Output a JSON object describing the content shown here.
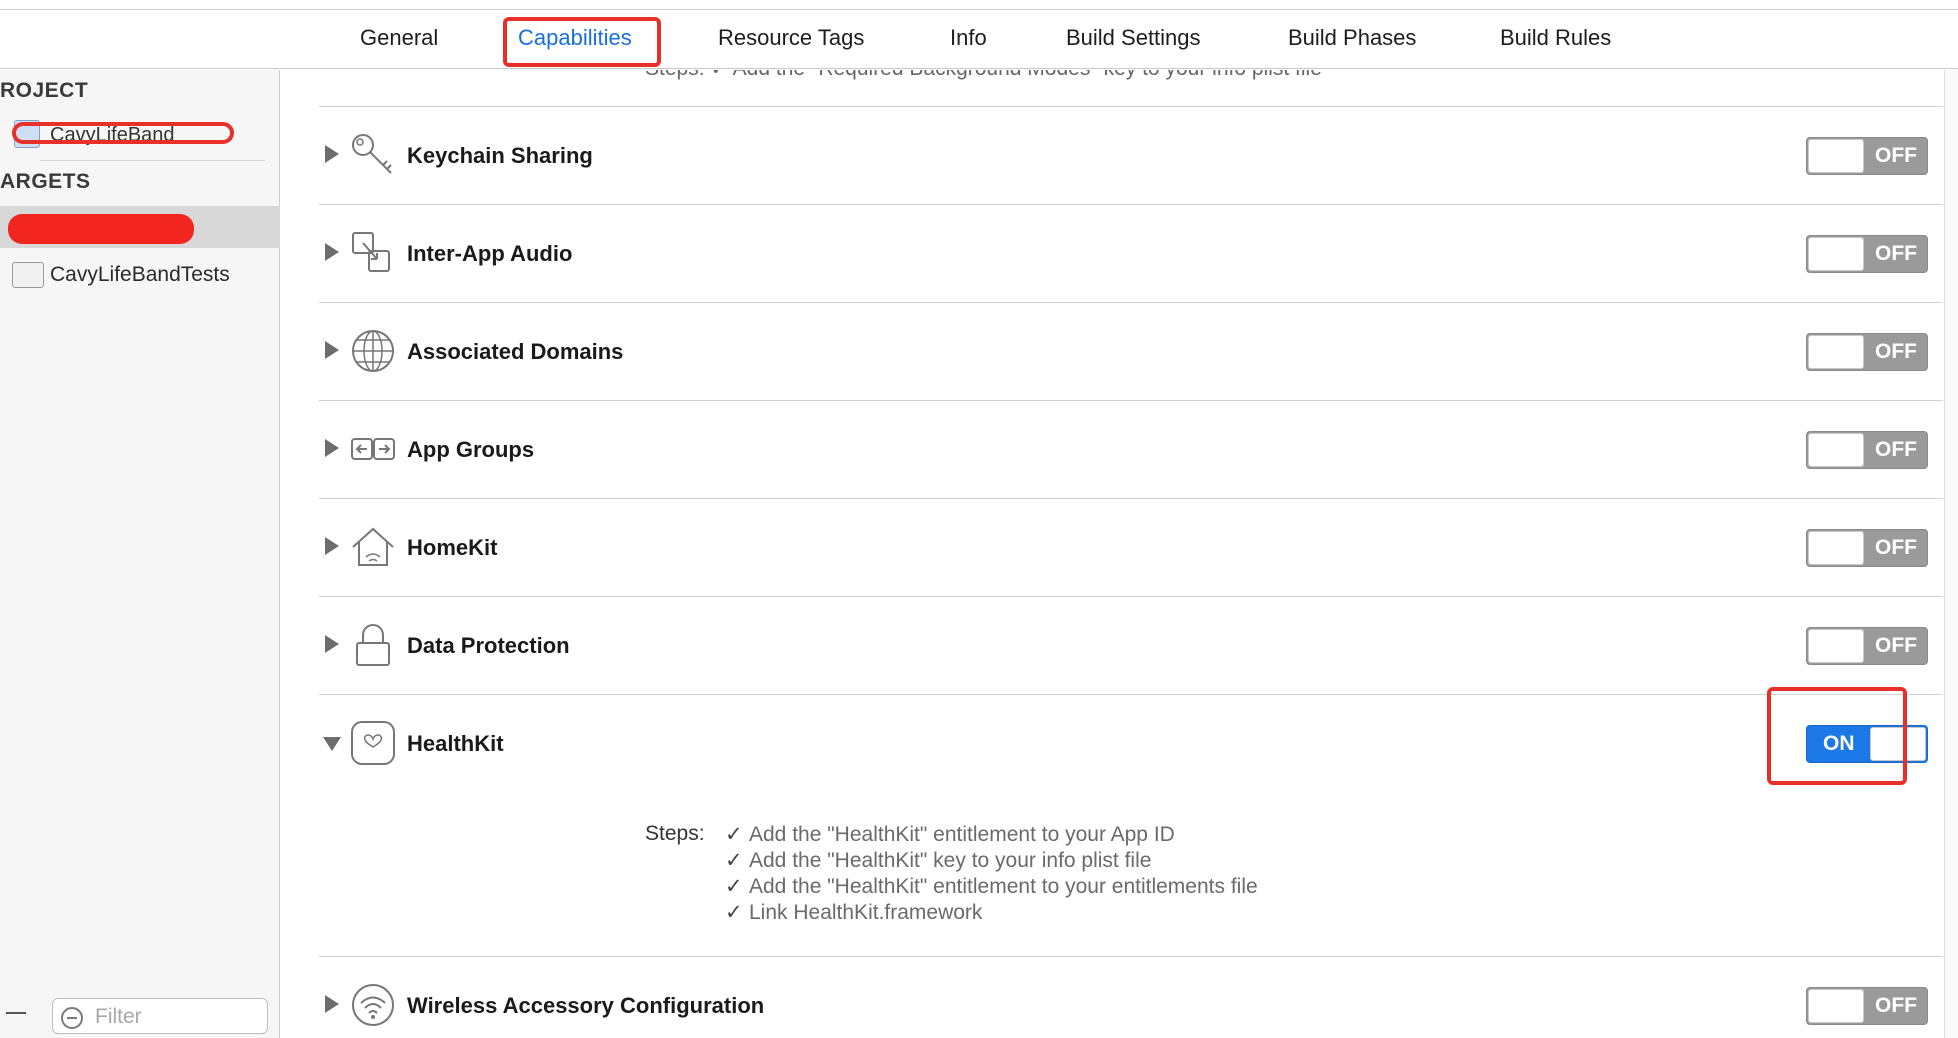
{
  "tabs": [
    {
      "label": "General"
    },
    {
      "label": "Capabilities"
    },
    {
      "label": "Resource Tags"
    },
    {
      "label": "Info"
    },
    {
      "label": "Build Settings"
    },
    {
      "label": "Build Phases"
    },
    {
      "label": "Build Rules"
    }
  ],
  "sidebar": {
    "project_header": "ROJECT",
    "project_item": "CavyLifeBand",
    "targets_header": "ARGETS",
    "targets": [
      {
        "label": ""
      },
      {
        "label": "CavyLifeBandTests"
      }
    ],
    "filter_placeholder": "Filter"
  },
  "main": {
    "cutoff_text": "Steps: ✓ Add the \"Required Background Modes\" key to your info plist file",
    "capabilities": [
      {
        "title": "Keychain Sharing",
        "icon": "key-icon",
        "state": "OFF"
      },
      {
        "title": "Inter-App Audio",
        "icon": "inter-app-audio-icon",
        "state": "OFF"
      },
      {
        "title": "Associated Domains",
        "icon": "globe-icon",
        "state": "OFF"
      },
      {
        "title": "App Groups",
        "icon": "app-groups-icon",
        "state": "OFF"
      },
      {
        "title": "HomeKit",
        "icon": "house-icon",
        "state": "OFF"
      },
      {
        "title": "Data Protection",
        "icon": "lock-icon",
        "state": "OFF"
      },
      {
        "title": "HealthKit",
        "icon": "heart-icon",
        "state": "ON"
      },
      {
        "title": "Wireless Accessory Configuration",
        "icon": "wireless-icon",
        "state": "OFF"
      }
    ],
    "healthkit_steps": {
      "label": "Steps:",
      "items": [
        "Add the \"HealthKit\" entitlement to your App ID",
        "Add the \"HealthKit\" key to your info plist file",
        "Add the \"HealthKit\" entitlement to your entitlements file",
        "Link HealthKit.framework"
      ]
    }
  },
  "colors": {
    "accent": "#1a6fe0",
    "toggle_on": "#1b78e6",
    "toggle_off": "#9a9a9a",
    "annotation_red": "#e8302a"
  }
}
